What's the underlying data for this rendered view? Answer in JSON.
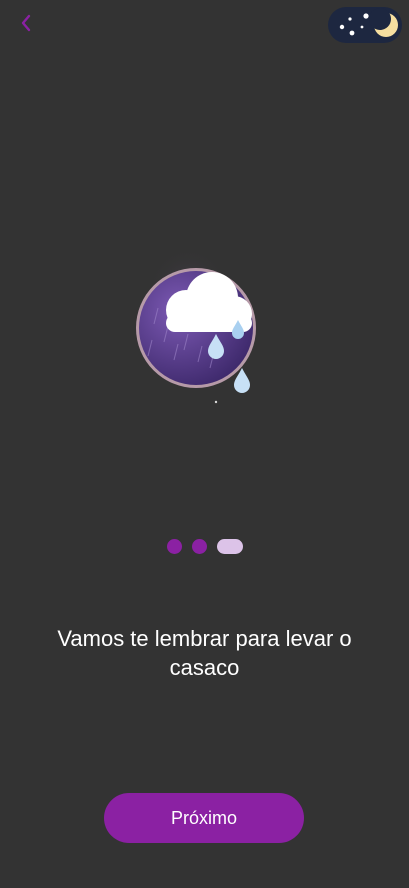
{
  "nav": {
    "back_icon": "chevron-left-icon",
    "theme_icon": "moon-stars-icon"
  },
  "illustration": {
    "icon": "rain-cloud-icon"
  },
  "pagination": {
    "total": 3,
    "current": 3
  },
  "content": {
    "message": "Vamos te lembrar para levar o casaco"
  },
  "actions": {
    "next_label": "Próximo"
  },
  "colors": {
    "background": "#333333",
    "accent": "#8b21a3",
    "active_dot": "#dcc3e8",
    "toggle_bg": "#1d2740"
  }
}
